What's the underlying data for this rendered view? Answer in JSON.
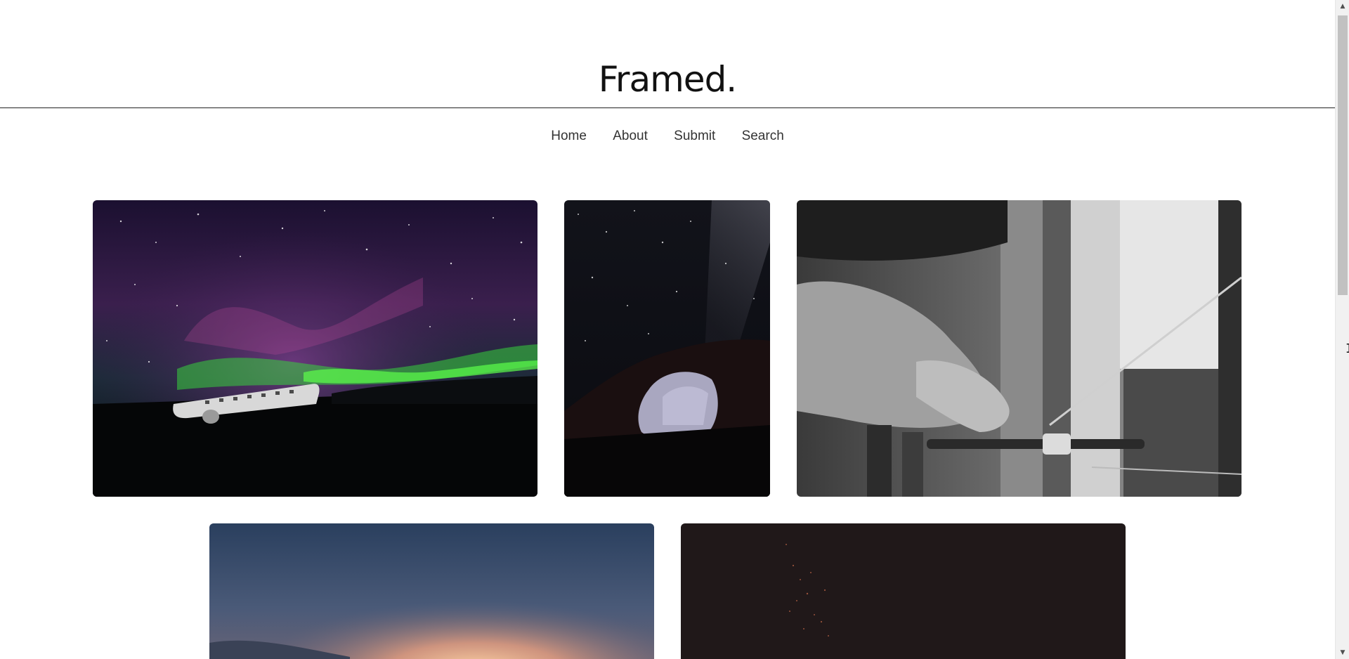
{
  "site": {
    "logo": "Framed."
  },
  "nav": {
    "items": [
      {
        "label": "Home"
      },
      {
        "label": "About"
      },
      {
        "label": "Submit"
      },
      {
        "label": "Search"
      }
    ]
  },
  "gallery": {
    "tiles": [
      {
        "subject": "aurora over plane wreck"
      },
      {
        "subject": "milky way over rock arch"
      },
      {
        "subject": "hands working a spinning machine"
      },
      {
        "subject": "glowing horizon at dusk"
      },
      {
        "subject": "dark starry sky"
      }
    ]
  },
  "scrollbar": {
    "up_icon": "triangle-up-icon",
    "down_icon": "triangle-down-icon"
  },
  "colors": {
    "text": "#222222",
    "rule": "#222222",
    "background": "#ffffff"
  }
}
